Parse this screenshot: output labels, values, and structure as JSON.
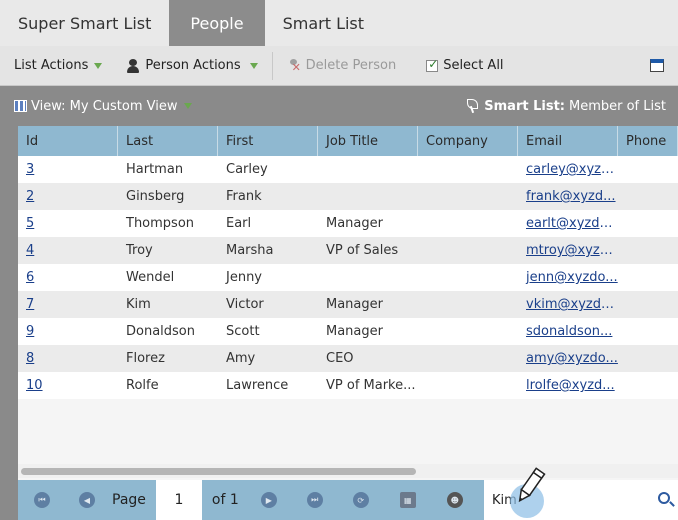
{
  "tabs": [
    {
      "label": "Super Smart List",
      "active": false
    },
    {
      "label": "People",
      "active": true
    },
    {
      "label": "Smart List",
      "active": false
    }
  ],
  "toolbar": {
    "list_actions": "List Actions",
    "person_actions": "Person Actions",
    "delete_person": "Delete Person",
    "select_all": "Select All",
    "accent_color": "#6aa84f"
  },
  "view": {
    "label": "View: My Custom View",
    "smart_list_label": "Smart List:",
    "smart_list_value": "Member of List"
  },
  "grid": {
    "columns": [
      "Id",
      "Last",
      "First",
      "Job Title",
      "Company",
      "Email",
      "Phone"
    ],
    "rows": [
      [
        "3",
        "Hartman",
        "Carley",
        "",
        "",
        "carley@xyzd...",
        ""
      ],
      [
        "2",
        "Ginsberg",
        "Frank",
        "",
        "",
        "frank@xyzd...",
        ""
      ],
      [
        "5",
        "Thompson",
        "Earl",
        "Manager",
        "",
        "earlt@xyzdo...",
        ""
      ],
      [
        "4",
        "Troy",
        "Marsha",
        "VP of Sales",
        "",
        "mtroy@xyzd...",
        ""
      ],
      [
        "6",
        "Wendel",
        "Jenny",
        "",
        "",
        "jenn@xyzdo...",
        ""
      ],
      [
        "7",
        "Kim",
        "Victor",
        "Manager",
        "",
        "vkim@xyzdo...",
        ""
      ],
      [
        "9",
        "Donaldson",
        "Scott",
        "Manager",
        "",
        "sdonaldson...",
        ""
      ],
      [
        "8",
        "Florez",
        "Amy",
        "CEO",
        "",
        "amy@xyzdo...",
        ""
      ],
      [
        "10",
        "Rolfe",
        "Lawrence",
        "VP of Marke...",
        "",
        "lrolfe@xyzd...",
        ""
      ]
    ],
    "header_color": "#8fb8d0"
  },
  "pager": {
    "page_label": "Page",
    "page_value": "1",
    "of_label": "of 1",
    "filter_value": "Kim"
  }
}
